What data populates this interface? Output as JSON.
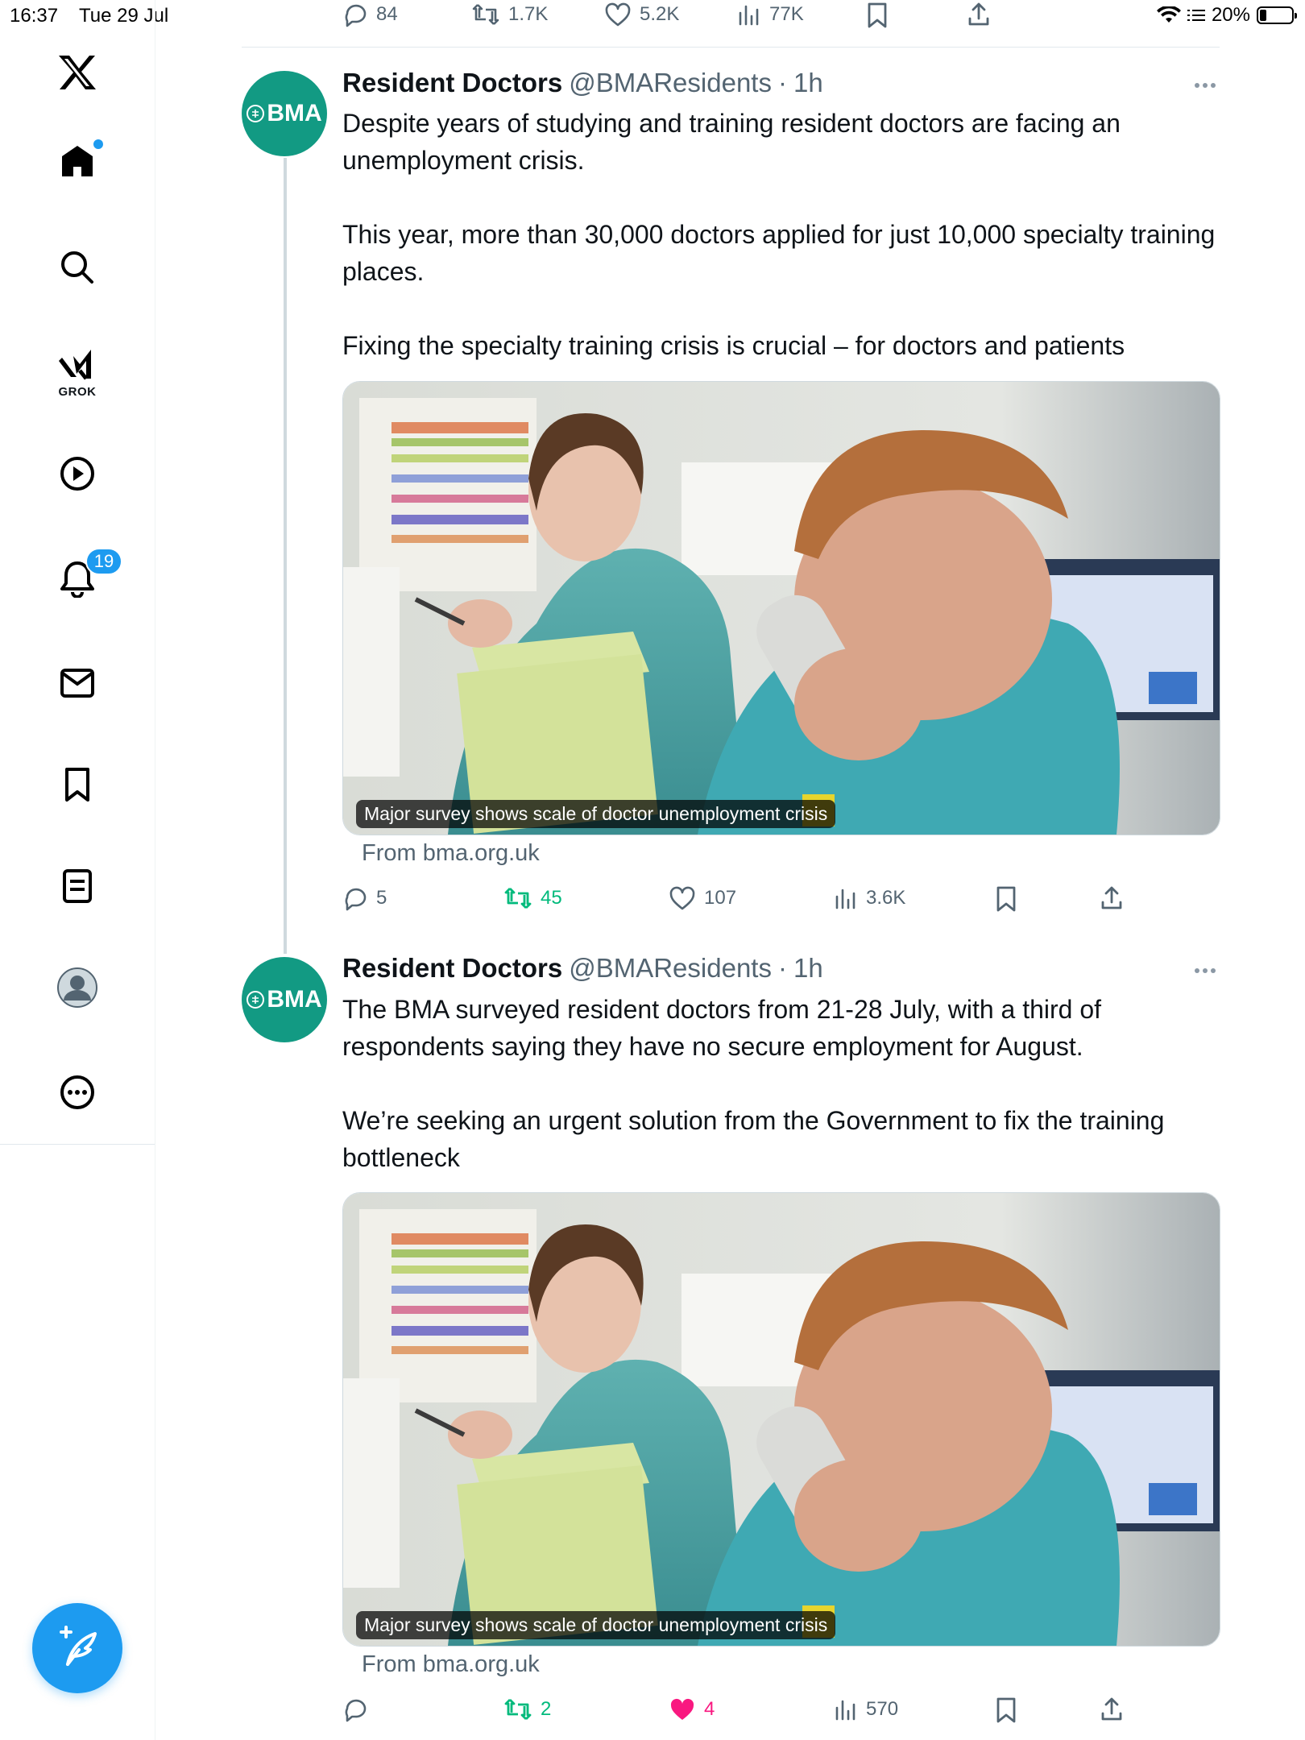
{
  "status_bar": {
    "time": "16:37",
    "date": "Tue 29 Jul",
    "battery": "20%"
  },
  "sidebar": {
    "notification_count": "19",
    "grok_label": "GROK"
  },
  "top_actions": {
    "replies": "84",
    "reposts": "1.7K",
    "likes": "5.2K",
    "views": "77K"
  },
  "tweets": [
    {
      "avatar_text": "BMA",
      "name": "Resident Doctors",
      "handle": "@BMAResidents",
      "separator": "·",
      "time": "1h",
      "paragraphs": [
        "Despite years of studying and training resident doctors are facing an unemployment crisis.",
        "This year, more than 30,000 doctors applied for just 10,000 specialty training places.",
        "Fixing the specialty training crisis is crucial – for doctors and patients"
      ],
      "card_caption": "Major survey shows scale of doctor unemployment crisis",
      "card_source": "From bma.org.uk",
      "replies": "5",
      "reposts": "45",
      "likes": "107",
      "views": "3.6K"
    },
    {
      "avatar_text": "BMA",
      "name": "Resident Doctors",
      "handle": "@BMAResidents",
      "separator": "·",
      "time": "1h",
      "paragraphs": [
        "The BMA surveyed resident doctors from 21-28 July, with a third of respondents saying they have no secure employment for August.",
        "We’re seeking an urgent solution from the Government to fix the training bottleneck"
      ],
      "card_caption": "Major survey shows scale of doctor unemployment crisis",
      "card_source": "From bma.org.uk",
      "replies": "",
      "reposts": "2",
      "likes": "4",
      "views": "570"
    }
  ],
  "colors": {
    "accent": "#1d9bf0",
    "repost_green": "#00ba7c",
    "like_pink": "#f91880",
    "brand_avatar": "#129a83",
    "muted_text": "#536471"
  }
}
